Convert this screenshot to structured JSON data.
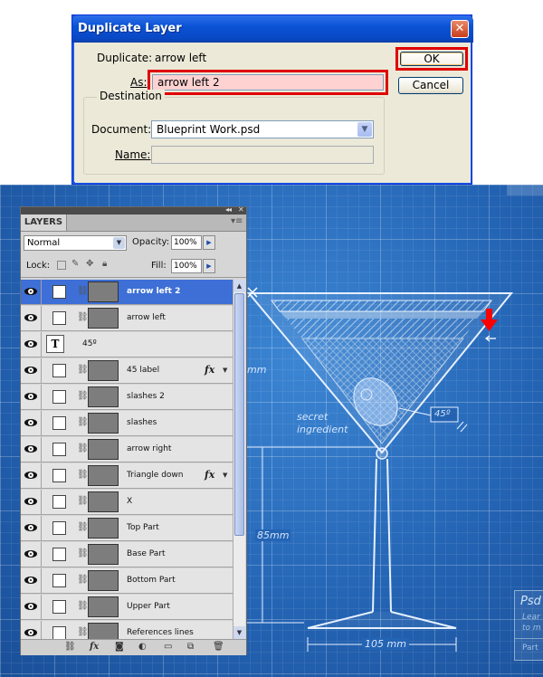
{
  "dialog": {
    "title": "Duplicate Layer",
    "close_glyph": "✕",
    "duplicate_label": "Duplicate:",
    "duplicate_value": "arrow left",
    "as_label": "As:",
    "as_value": "arrow left 2",
    "ok_label": "OK",
    "cancel_label": "Cancel",
    "destination_legend": "Destination",
    "document_label": "Document:",
    "document_value": "Blueprint Work.psd",
    "name_label": "Name:",
    "name_value": ""
  },
  "layers_panel": {
    "tab_label": "LAYERS",
    "blend_mode": "Normal",
    "opacity_label": "Opacity:",
    "opacity_value": "100%",
    "lock_label": "Lock:",
    "fill_label": "Fill:",
    "fill_value": "100%",
    "layers": [
      {
        "name": "arrow left 2",
        "selected": true,
        "type": "smart"
      },
      {
        "name": "arrow left",
        "type": "smart"
      },
      {
        "name": "45º",
        "type": "text"
      },
      {
        "name": "45 label",
        "type": "smart",
        "fx": true
      },
      {
        "name": "slashes 2",
        "type": "smart"
      },
      {
        "name": "slashes",
        "type": "smart"
      },
      {
        "name": "arrow right",
        "type": "smart"
      },
      {
        "name": "Triangle down",
        "type": "smart",
        "fx": true
      },
      {
        "name": "X",
        "type": "smart"
      },
      {
        "name": "Top Part",
        "type": "smart"
      },
      {
        "name": "Base Part",
        "type": "smart"
      },
      {
        "name": "Bottom Part",
        "type": "smart"
      },
      {
        "name": "Upper Part",
        "type": "smart"
      },
      {
        "name": "References lines",
        "type": "smart"
      }
    ],
    "fx_glyph": "fx"
  },
  "blueprint": {
    "mm_left": "mm",
    "secret_line1": "secret",
    "secret_line2": "ingredient",
    "angle_label": "45º",
    "height_label": "85mm",
    "width_label": "105 mm",
    "psd_title": "Psd",
    "psd_sub1": "Lear",
    "psd_sub2": "to m",
    "psd_sub3": "Part"
  },
  "colors": {
    "highlight_red": "#e00000",
    "blueprint_blue": "#2464b4",
    "selection_blue": "#3d6fd6",
    "arrow_red": "#ff0000"
  }
}
